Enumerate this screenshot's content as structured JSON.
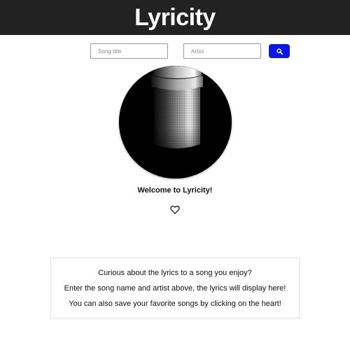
{
  "header": {
    "title": "Lyricity"
  },
  "search": {
    "song_placeholder": "Song title",
    "artist_placeholder": "Artist",
    "button_icon": "search-icon"
  },
  "colors": {
    "header_bg": "#222222",
    "accent": "#0b16e8"
  },
  "hero": {
    "image": "microphone-image"
  },
  "welcome": {
    "text": "Welcome to Lyricity!",
    "favorite_icon": "heart-outline-icon"
  },
  "info": {
    "lines": [
      "Curious about the lyrics to a song you enjoy?",
      "Enter the song name and artist above, the lyrics will display here!",
      "You can also save your favorite songs by clicking on the heart!"
    ]
  }
}
